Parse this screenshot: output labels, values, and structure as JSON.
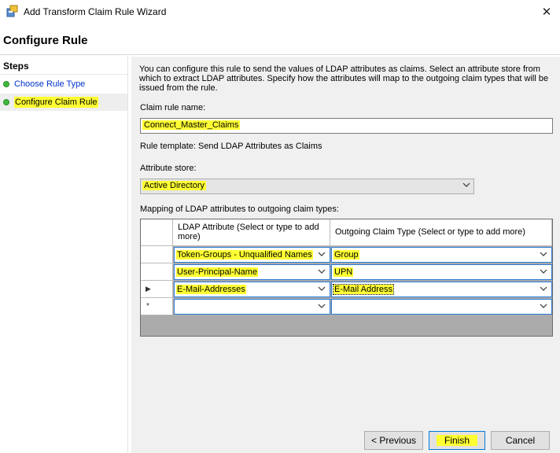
{
  "window": {
    "title": "Add Transform Claim Rule Wizard",
    "close_glyph": "✕",
    "icon": "wizard-icon"
  },
  "header": {
    "title": "Configure Rule"
  },
  "steps": {
    "title": "Steps",
    "items": [
      {
        "label": "Choose Rule Type"
      },
      {
        "label": "Configure Claim Rule"
      }
    ]
  },
  "main": {
    "description": "You can configure this rule to send the values of LDAP attributes as claims. Select an attribute store from which to extract LDAP attributes. Specify how the attributes will map to the outgoing claim types that will be issued from the rule.",
    "claim_rule_name_label": "Claim rule name:",
    "claim_rule_name_value": "Connect_Master_Claims",
    "rule_template": "Rule template: Send LDAP Attributes as Claims",
    "attribute_store_label": "Attribute store:",
    "attribute_store_value": "Active Directory",
    "mapping_label": "Mapping of LDAP attributes to outgoing claim types:",
    "grid": {
      "col_ldap": "LDAP Attribute (Select or type to add more)",
      "col_claim": "Outgoing Claim Type (Select or type to add more)",
      "new_row_marker": "*",
      "current_row_marker": "▶",
      "rows": [
        {
          "ldap": "Token-Groups - Unqualified Names",
          "claim": "Group"
        },
        {
          "ldap": "User-Principal-Name",
          "claim": "UPN"
        },
        {
          "ldap": "E-Mail-Addresses",
          "claim": "E-Mail Address"
        },
        {
          "ldap": "",
          "claim": ""
        }
      ]
    }
  },
  "buttons": {
    "previous": "< Previous",
    "finish": "Finish",
    "cancel": "Cancel"
  },
  "colors": {
    "highlight": "#ffff33",
    "step_dot": "#3fba3f",
    "link": "#0033cc",
    "focus_border": "#2e7bd6"
  }
}
